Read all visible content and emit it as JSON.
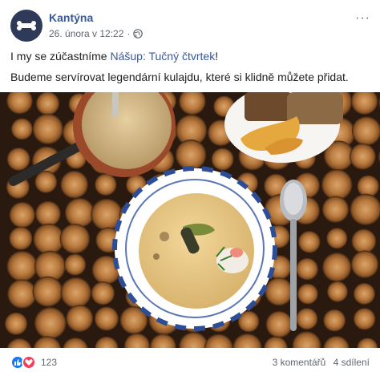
{
  "post": {
    "page_name": "Kantýna",
    "timestamp": "26. února v 12:22",
    "separator": "·",
    "privacy_icon": "globe-icon",
    "more_icon": "more-options-icon",
    "more_label": "···",
    "line1_prefix": "I my se zúčastníme ",
    "line1_link": "Nášup: Tučný čtvrtek",
    "line1_suffix": "!",
    "line2": "Budeme servírovat legendární kulajdu, které si klidně můžete přidat.",
    "photo_icon": "food-photo"
  },
  "footer": {
    "reaction_icons": [
      "like-icon",
      "love-icon"
    ],
    "reaction_count": "123",
    "comments": "3 komentářů",
    "shares": "4 sdílení"
  },
  "colors": {
    "link": "#385898",
    "like": "#1877f2",
    "love": "#f33e58",
    "avatar_bg": "#2e3a57"
  }
}
